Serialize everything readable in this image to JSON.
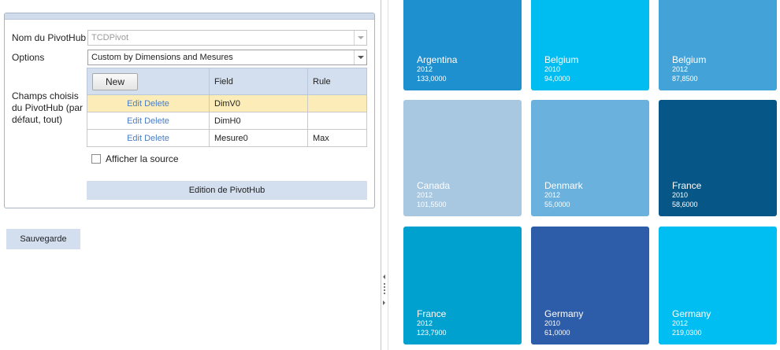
{
  "form": {
    "pivothub_name_label": "Nom du PivotHub",
    "pivothub_name_value": "TCDPivot",
    "options_label": "Options",
    "options_value": "Custom by Dimensions and Mesures",
    "fields_label": "Champs choisis du PivotHub (par défaut, tout)",
    "new_button": "New",
    "columns": {
      "actions": "",
      "field": "Field",
      "rule": "Rule"
    },
    "rows": [
      {
        "edit": "Edit",
        "delete": "Delete",
        "field": "DimV0",
        "rule": ""
      },
      {
        "edit": "Edit",
        "delete": "Delete",
        "field": "DimH0",
        "rule": ""
      },
      {
        "edit": "Edit",
        "delete": "Delete",
        "field": "Mesure0",
        "rule": "Max"
      }
    ],
    "show_source_label": "Afficher la source",
    "edit_bar": "Edition de PivotHub",
    "save_button": "Sauvegarde"
  },
  "tiles": [
    {
      "country": "Argentina",
      "year": "2012",
      "value": "133,0000",
      "color": "#1e8fcf"
    },
    {
      "country": "Belgium",
      "year": "2010",
      "value": "94,0000",
      "color": "#00bdf1"
    },
    {
      "country": "Belgium",
      "year": "2012",
      "value": "87,8500",
      "color": "#43a3d8"
    },
    {
      "country": "Canada",
      "year": "2012",
      "value": "101,5500",
      "color": "#a8c7e0"
    },
    {
      "country": "Denmark",
      "year": "2012",
      "value": "55,0000",
      "color": "#6ab1dd"
    },
    {
      "country": "France",
      "year": "2010",
      "value": "58,6000",
      "color": "#065788"
    },
    {
      "country": "France",
      "year": "2012",
      "value": "123,7900",
      "color": "#00a0cf"
    },
    {
      "country": "Germany",
      "year": "2010",
      "value": "61,0000",
      "color": "#2d5ca8"
    },
    {
      "country": "Germany",
      "year": "2012",
      "value": "219,0300",
      "color": "#00bef2"
    }
  ]
}
